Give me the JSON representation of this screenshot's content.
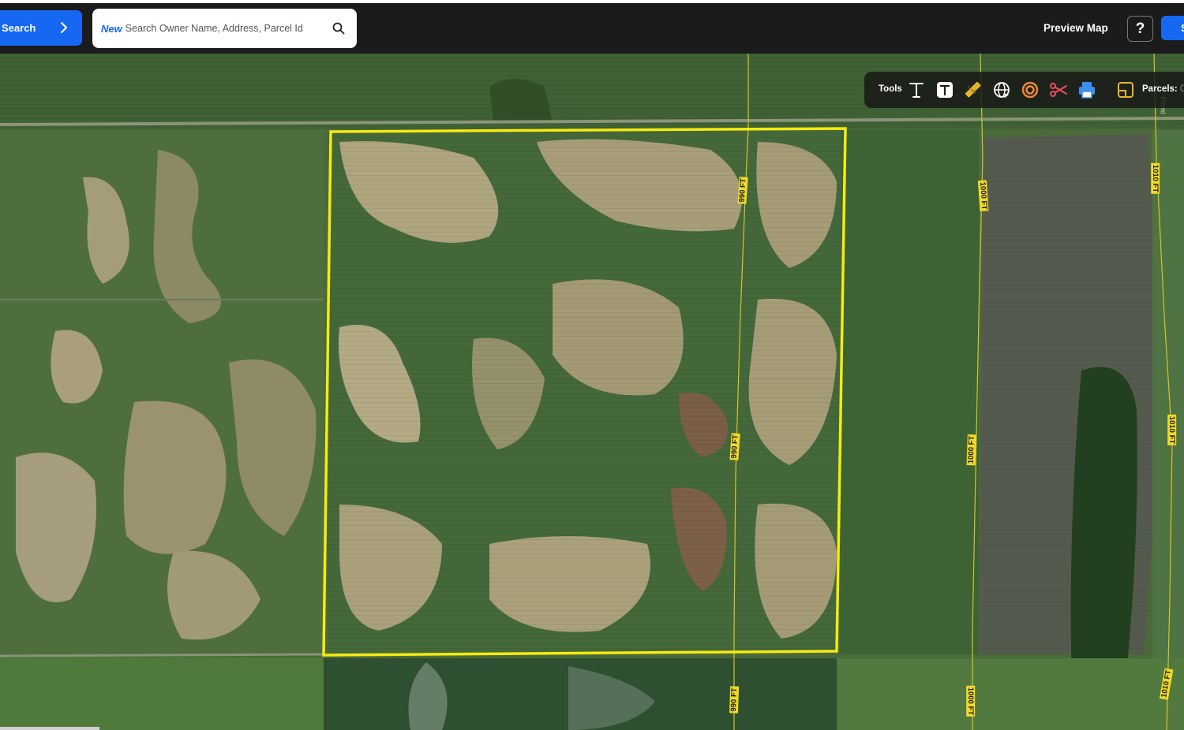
{
  "header": {
    "search_button_label": "Search",
    "search_new_tag": "New",
    "search_placeholder": "Search Owner Name, Address, Parcel Id",
    "preview_map_label": "Preview Map",
    "help_label": "?",
    "save_label": "Save"
  },
  "toolbar": {
    "tools_label": "Tools",
    "tools": [
      {
        "name": "text-tool",
        "icon": "text-icon"
      },
      {
        "name": "text-box-tool",
        "icon": "text-box-icon"
      },
      {
        "name": "measure-tool",
        "icon": "ruler-icon"
      },
      {
        "name": "globe-tool",
        "icon": "globe-icon"
      },
      {
        "name": "buffer-tool",
        "icon": "buffer-ring-icon"
      },
      {
        "name": "split-tool",
        "icon": "scissors-icon"
      },
      {
        "name": "print-tool",
        "icon": "printer-icon"
      }
    ],
    "parcels_label": "Parcels:",
    "parcels_value": "On"
  },
  "map": {
    "basemap": "satellite-imagery",
    "boundary_color": "#f5ea12",
    "line_labels": [
      "990 FT",
      "990 FT",
      "990 FT",
      "1000 FT",
      "1000 FT",
      "1000 FT",
      "1010 FT",
      "1010 FT",
      "1010 FT",
      "Pemi"
    ]
  },
  "colors": {
    "accent": "#1668f2",
    "header_bg": "#1b1b1b",
    "label_bg": "#f0da2a"
  }
}
